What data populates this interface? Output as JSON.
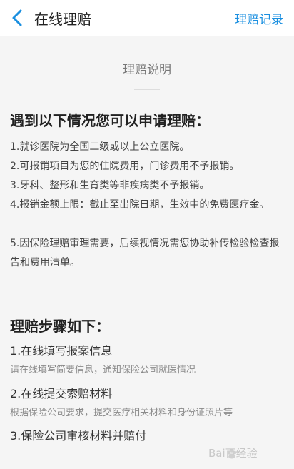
{
  "header": {
    "title": "在线理赔",
    "action": "理赔记录"
  },
  "intro": {
    "title": "理赔说明"
  },
  "conditions": {
    "heading": "遇到以下情况您可以申请理赔：",
    "items": [
      "1.就诊医院为全国二级或以上公立医院。",
      "2.可报销项目为您的住院费用，门诊费用不予报销。",
      "3.牙科、整形和生育类等非疾病类不予报销。",
      "4.报销金额上限：截止至出院日期，生效中的免费医疗金。",
      "5.因保险理赔审理需要，后续视情况需您协助补传检验检查报告和费用清单。"
    ]
  },
  "steps": {
    "heading": "理赔步骤如下：",
    "items": [
      {
        "title": "1.在线填写报案信息",
        "desc": "请在线填写简要信息，通知保险公司就医情况"
      },
      {
        "title": "2.在线提交索赔材料",
        "desc": "根据保险公司要求，提交医疗相关材料和身份证照片等"
      },
      {
        "title": "3.保险公司审核材料并赔付",
        "desc": ""
      }
    ]
  },
  "watermark": {
    "text": "Bai百经验"
  }
}
